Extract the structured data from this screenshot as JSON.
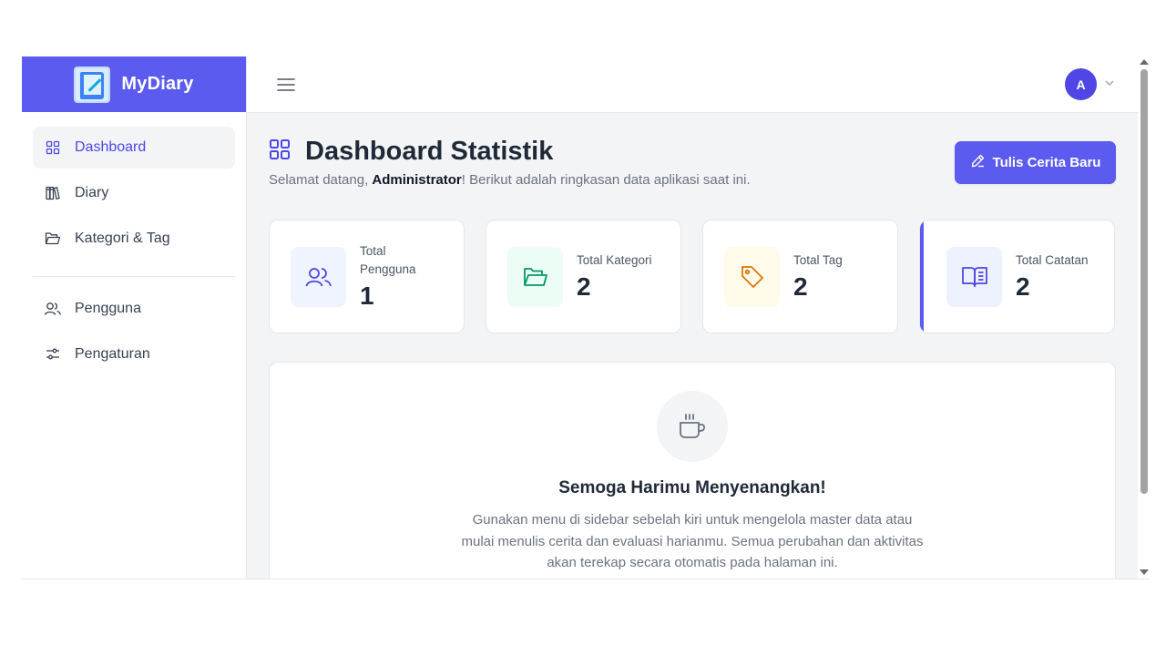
{
  "brand": {
    "name": "MyDiary"
  },
  "sidebar": {
    "items": [
      {
        "label": "Dashboard",
        "icon": "grid-icon",
        "active": true
      },
      {
        "label": "Diary",
        "icon": "books-icon"
      },
      {
        "label": "Kategori & Tag",
        "icon": "folder-icon"
      },
      {
        "label": "Pengguna",
        "icon": "users-icon"
      },
      {
        "label": "Pengaturan",
        "icon": "sliders-icon"
      }
    ]
  },
  "topbar": {
    "avatar_initial": "A"
  },
  "header": {
    "title": "Dashboard Statistik",
    "subtitle_prefix": "Selamat datang, ",
    "subtitle_user": "Administrator",
    "subtitle_suffix": "! Berikut adalah ringkasan data aplikasi saat ini.",
    "new_button_label": "Tulis Cerita Baru"
  },
  "stats": [
    {
      "label": "Total Pengguna",
      "value": "1",
      "icon": "users-icon",
      "color": "#4f46e5",
      "bg": "#eff4ff"
    },
    {
      "label": "Total Kategori",
      "value": "2",
      "icon": "folder-icon",
      "color": "#059669",
      "bg": "#ecfdf5"
    },
    {
      "label": "Total Tag",
      "value": "2",
      "icon": "tag-icon",
      "color": "#d97706",
      "bg": "#fffbeb"
    },
    {
      "label": "Total Catatan",
      "value": "2",
      "icon": "open-book-icon",
      "color": "#4f46e5",
      "bg": "#eef2ff"
    }
  ],
  "welcome": {
    "icon": "coffee-cup-icon",
    "title": "Semoga Harimu Menyenangkan!",
    "text": "Gunakan menu di sidebar sebelah kiri untuk mengelola master data atau mulai menulis cerita dan evaluasi harianmu. Semua perubahan dan aktivitas akan terekap secara otomatis pada halaman ini."
  },
  "colors": {
    "primary": "#5b5bf0",
    "background": "#f3f4f6"
  }
}
